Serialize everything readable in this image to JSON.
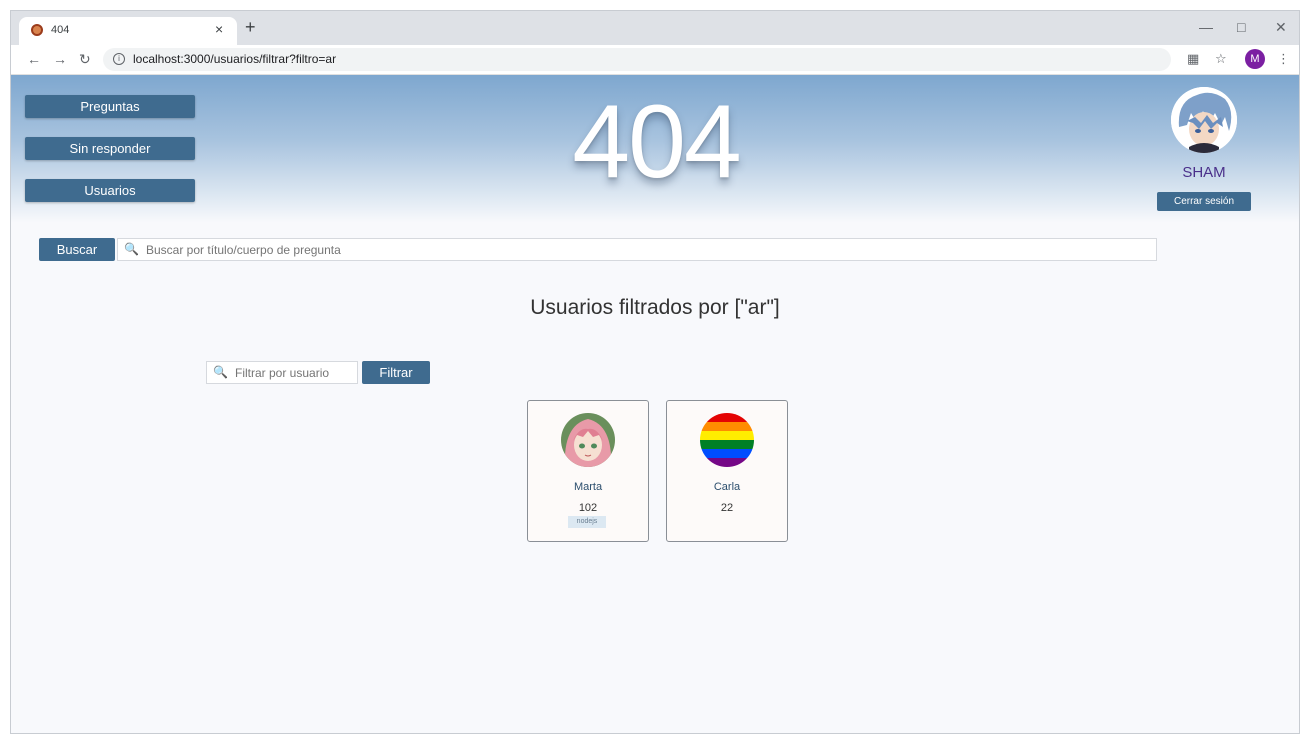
{
  "browser": {
    "tab_title": "404",
    "tab_close": "×",
    "new_tab": "+",
    "url": "localhost:3000/usuarios/filtrar?filtro=ar",
    "profile_initial": "M"
  },
  "nav": {
    "preguntas": "Preguntas",
    "sin_responder": "Sin responder",
    "usuarios": "Usuarios"
  },
  "logo": "404",
  "user": {
    "name": "SHAM",
    "logout": "Cerrar sesión"
  },
  "search": {
    "button": "Buscar",
    "placeholder": "Buscar por título/cuerpo de pregunta"
  },
  "page_title": "Usuarios filtrados por [\"ar\"]",
  "filter": {
    "placeholder": "Filtrar por usuario",
    "button": "Filtrar"
  },
  "users": [
    {
      "name": "Marta",
      "reputation": "102",
      "tag": "nodejs"
    },
    {
      "name": "Carla",
      "reputation": "22",
      "tag": ""
    }
  ],
  "colors": {
    "accent": "#3f6b8f",
    "username": "#4a2f8a"
  }
}
